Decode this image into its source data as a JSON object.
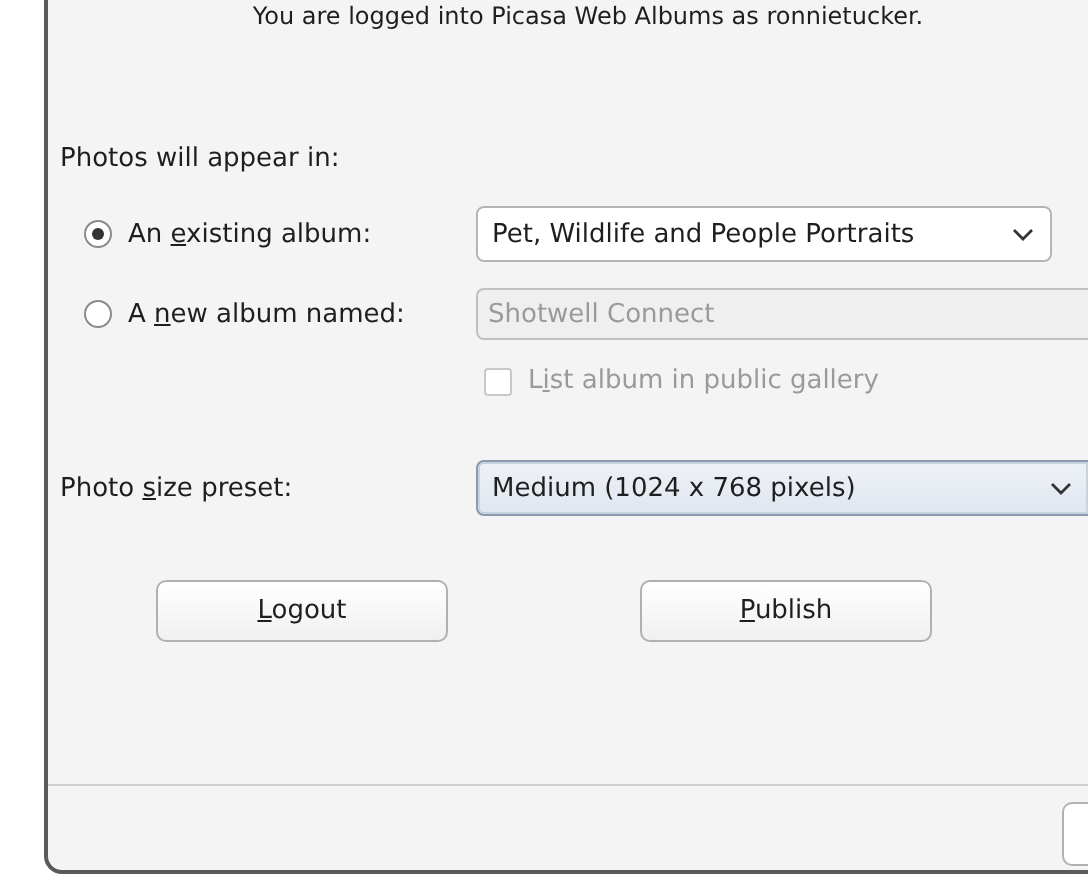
{
  "login_message": "You are logged into Picasa Web Albums as ronnietucker.",
  "destination": {
    "heading": "Photos will appear in:",
    "options": [
      {
        "kind": "combo",
        "selected": true,
        "label": {
          "pre": "An ",
          "key": "e",
          "rest": "xisting album:"
        },
        "value": "Pet, Wildlife and People Portraits"
      },
      {
        "kind": "entry",
        "selected": false,
        "label": {
          "pre": "A ",
          "key": "n",
          "rest": "ew album named:"
        },
        "value": "Shotwell Connect",
        "disabled": true
      }
    ],
    "public_gallery": {
      "label": {
        "pre": "L",
        "key": "i",
        "rest": "st album in public gallery"
      },
      "checked": false,
      "disabled": true
    }
  },
  "size_preset": {
    "label": {
      "pre": "Photo ",
      "key": "s",
      "rest": "ize preset:"
    },
    "value": "Medium (1024 x 768 pixels)"
  },
  "buttons": [
    {
      "label": {
        "key": "L",
        "rest": "ogout"
      }
    },
    {
      "label": {
        "key": "P",
        "rest": "ublish"
      }
    }
  ]
}
